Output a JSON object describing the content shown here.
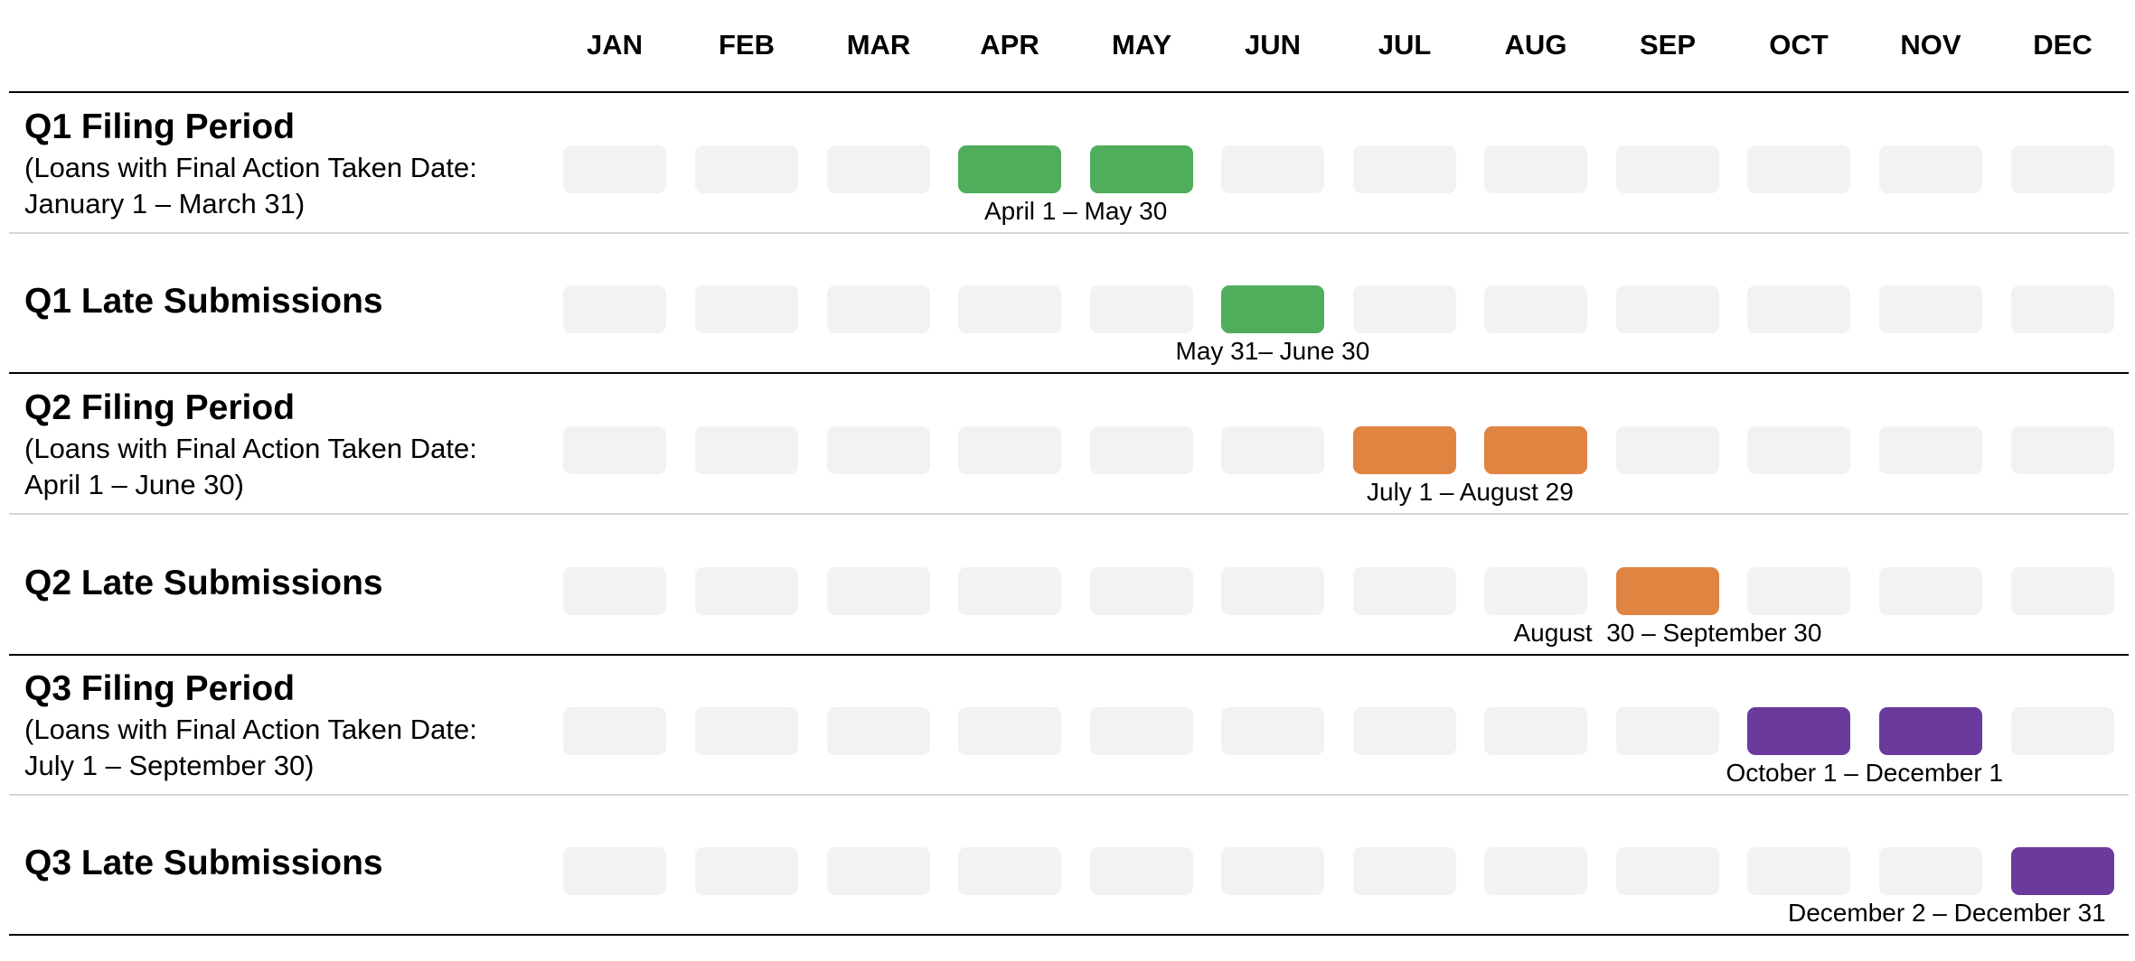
{
  "months": [
    "JAN",
    "FEB",
    "MAR",
    "APR",
    "MAY",
    "JUN",
    "JUL",
    "AUG",
    "SEP",
    "OCT",
    "NOV",
    "DEC"
  ],
  "colors": {
    "empty": "#f2f2f2",
    "q1": "#4fad5b",
    "q2": "#e08441",
    "q3": "#6a3a9c"
  },
  "rows": [
    {
      "title": "Q1 Filing Period",
      "subtitle_line1": "(Loans with Final Action Taken Date:",
      "subtitle_line2": "January 1 – March 31)",
      "active_months": [
        "APR",
        "MAY"
      ],
      "color": "q1",
      "range_label": "April 1 – May 30"
    },
    {
      "title": "Q1 Late Submissions",
      "subtitle_line1": "",
      "subtitle_line2": "",
      "active_months": [
        "JUN"
      ],
      "color": "q1",
      "range_label": "May 31– June 30"
    },
    {
      "title": "Q2 Filing Period",
      "subtitle_line1": "(Loans with Final Action Taken Date:",
      "subtitle_line2": "April 1 – June 30)",
      "active_months": [
        "JUL",
        "AUG"
      ],
      "color": "q2",
      "range_label": "July 1 – August 29"
    },
    {
      "title": "Q2 Late Submissions",
      "subtitle_line1": "",
      "subtitle_line2": "",
      "active_months": [
        "SEP"
      ],
      "color": "q2",
      "range_label": "August  30 – September 30"
    },
    {
      "title": "Q3 Filing Period",
      "subtitle_line1": "(Loans with Final Action Taken Date:",
      "subtitle_line2": "July 1 – September 30)",
      "active_months": [
        "OCT",
        "NOV"
      ],
      "color": "q3",
      "range_label": "October 1 – December 1"
    },
    {
      "title": "Q3 Late Submissions",
      "subtitle_line1": "",
      "subtitle_line2": "",
      "active_months": [
        "DEC"
      ],
      "color": "q3",
      "range_label": "December 2 – December 31"
    }
  ]
}
